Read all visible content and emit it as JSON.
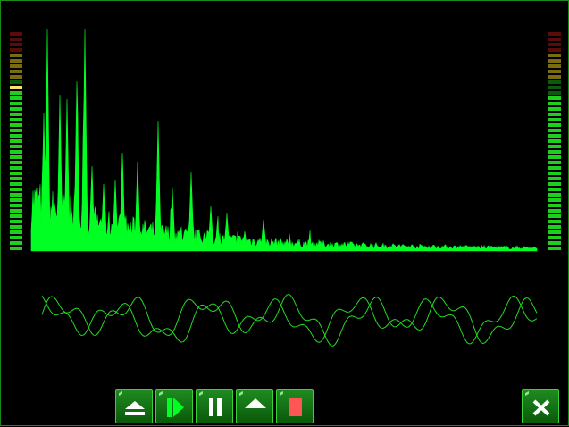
{
  "colors": {
    "background": "#000000",
    "spectrum": "#00ff22",
    "waveform": "#22dd22",
    "meter_on_green": "#1ecf1e",
    "meter_on_yellow": "#ffe066",
    "meter_dim_green": "#0c5a0c",
    "meter_dim_yellow": "#7a6a10",
    "meter_dim_red": "#5a0c0c",
    "stop_square": "#ff5555"
  },
  "meters": {
    "left": {
      "level": 0.76,
      "peak": 0.76
    },
    "right": {
      "level": 0.71,
      "peak": 0.71
    }
  },
  "controls": [
    {
      "id": "eject",
      "icon": "eject-icon"
    },
    {
      "id": "play",
      "icon": "play-icon"
    },
    {
      "id": "pause",
      "icon": "pause-icon"
    },
    {
      "id": "up",
      "icon": "up-arrow-icon"
    },
    {
      "id": "stop",
      "icon": "stop-icon"
    },
    {
      "id": "close",
      "icon": "close-icon"
    }
  ]
}
